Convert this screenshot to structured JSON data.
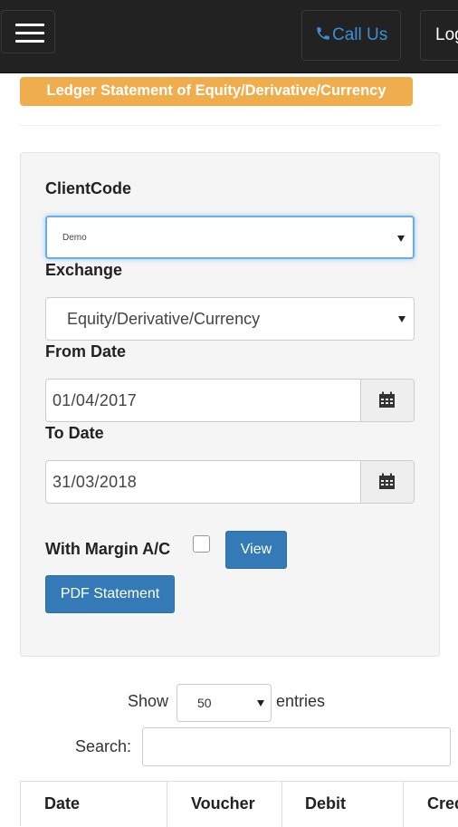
{
  "navbar": {
    "call_label": "Call Us",
    "login_label": "Log",
    "icons": [
      "hamburger-icon",
      "phone-icon"
    ],
    "link_color": "#3d8fd6"
  },
  "page": {
    "title": "Ledger Statement of Equity/Derivative/Currency",
    "title_color": "#f0ad4e"
  },
  "form": {
    "client_code_label": "ClientCode",
    "client_code_value": "Demo",
    "exchange_label": "Exchange",
    "exchange_value": "Equity/Derivative/Currency",
    "from_date_label": "From Date",
    "from_date_value": "01/04/2017",
    "to_date_label": "To Date",
    "to_date_value": "31/03/2018",
    "margin_label": "With Margin A/C",
    "margin_checked": false,
    "view_label": "View",
    "pdf_label": "PDF Statement",
    "calendar_icon": "calendar-icon",
    "button_color": "#337ab7"
  },
  "table_controls": {
    "show_label": "Show",
    "entries_value": "50",
    "entries_label": "entries",
    "search_label": "Search:",
    "search_value": ""
  },
  "table": {
    "columns": [
      "Date",
      "Voucher",
      "Debit",
      "Cred"
    ]
  }
}
